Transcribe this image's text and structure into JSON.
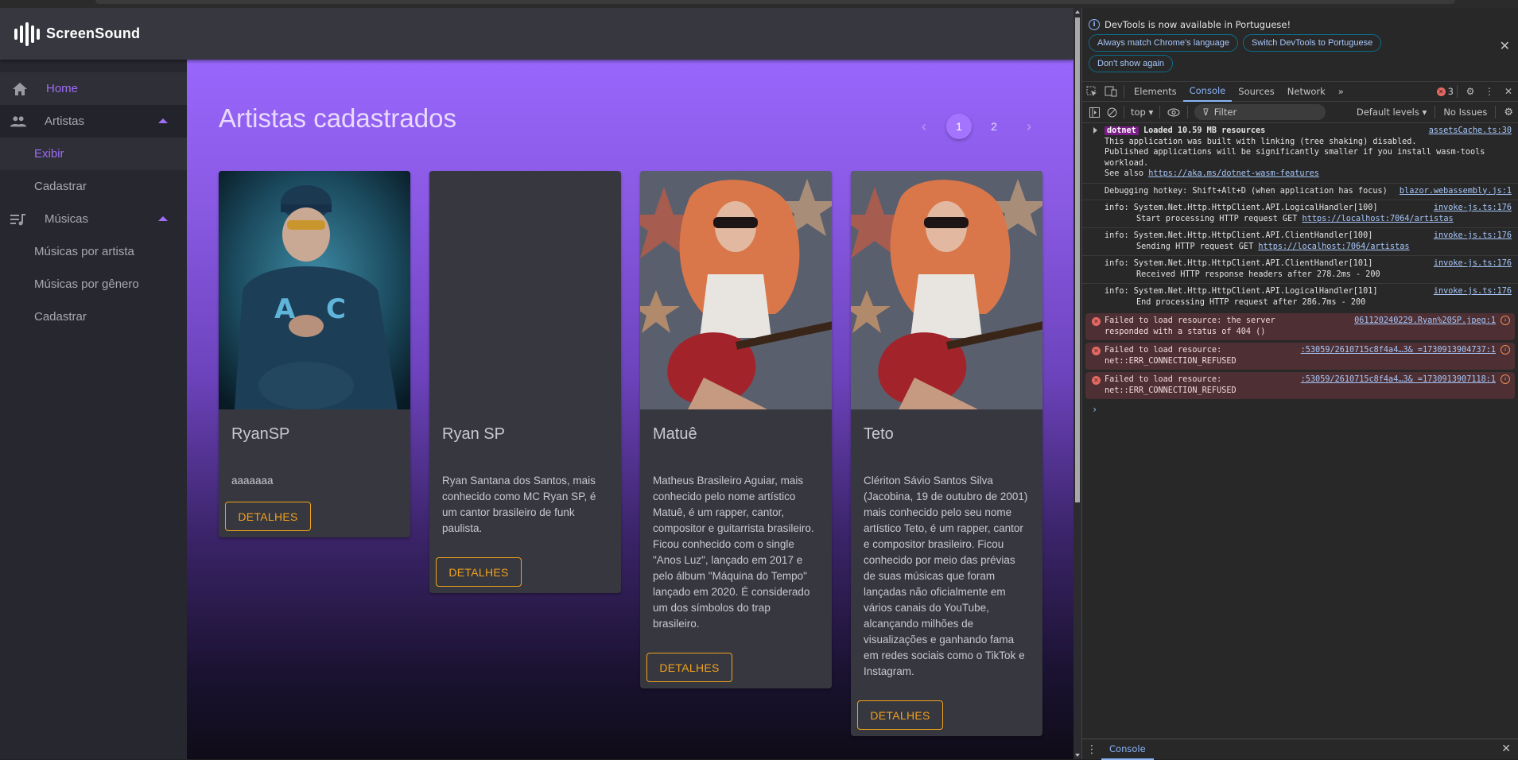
{
  "app": {
    "brand": "ScreenSound",
    "colors": {
      "accent": "#9e6cf6",
      "button": "#f0a21c",
      "card_bg": "#373740",
      "sidebar_bg": "#27272f"
    }
  },
  "sidebar": {
    "items": [
      {
        "label": "Home",
        "icon": "home-icon",
        "active": true
      },
      {
        "label": "Artistas",
        "icon": "people-icon",
        "expanded": true
      },
      {
        "label": "Exibir",
        "sub": true,
        "selected": true
      },
      {
        "label": "Cadastrar",
        "sub": true
      },
      {
        "label": "Músicas",
        "icon": "playlist-music-icon",
        "expanded": true
      },
      {
        "label": "Músicas por artista",
        "sub": true
      },
      {
        "label": "Músicas por gênero",
        "sub": true
      },
      {
        "label": "Cadastrar",
        "sub": true
      }
    ]
  },
  "main": {
    "title": "Artistas cadastrados",
    "pagination": {
      "prev": "‹",
      "pages": [
        "1",
        "2"
      ],
      "current": "1",
      "next": "›"
    },
    "cards": [
      {
        "name": "RyanSP",
        "description": "aaaaaaa",
        "image": "photo-rapper-blue-cap",
        "button": "DETALHES"
      },
      {
        "name": "Ryan SP",
        "description": "Ryan Santana dos Santos, mais conhecido como MC Ryan SP, é um cantor brasileiro de funk paulista.",
        "image": "",
        "button": "DETALHES"
      },
      {
        "name": "Matuê",
        "description": "Matheus Brasileiro Aguiar, mais conhecido pelo nome artístico Matuê, é um rapper, cantor, compositor e guitarrista brasileiro. Ficou conhecido com o single \"Anos Luz\", lançado em 2017 e pelo álbum \"Máquina do Tempo\" lançado em 2020. É considerado um dos símbolos do trap brasileiro.",
        "image": "painting-guitarist-red-hair",
        "button": "DETALHES"
      },
      {
        "name": "Teto",
        "description": "Clériton Sávio Santos Silva (Jacobina, 19 de outubro de 2001) mais conhecido pelo seu nome artístico Teto, é um rapper, cantor e compositor brasileiro. Ficou conhecido por meio das prévias de suas músicas que foram lançadas não oficialmente em vários canais do YouTube, alcançando milhões de visualizações e ganhando fama em redes sociais como o TikTok e Instagram.",
        "image": "painting-guitarist-red-hair",
        "button": "DETALHES"
      }
    ]
  },
  "devtools": {
    "banner": {
      "message": "DevTools is now available in Portuguese!",
      "buttons": [
        "Always match Chrome's language",
        "Switch DevTools to Portuguese",
        "Don't show again"
      ]
    },
    "tabs": [
      "Elements",
      "Console",
      "Sources",
      "Network"
    ],
    "active_tab": "Console",
    "more_tabs": "»",
    "error_count": "3",
    "toolbar": {
      "context": "top ▾",
      "filter_placeholder": "Filter",
      "levels": "Default levels ▾",
      "issues": "No Issues"
    },
    "logs": [
      {
        "type": "group",
        "tag": "dotnet",
        "text": "Loaded 10.59 MB resources",
        "lines": [
          "This application was built with linking (tree shaking) disabled.",
          "Published applications will be significantly smaller if you install wasm-tools workload."
        ],
        "see_also": "See also ",
        "link": "https://aka.ms/dotnet-wasm-features",
        "source": "assetsCache.ts:30"
      },
      {
        "type": "plain",
        "text": "Debugging hotkey: Shift+Alt+D (when application has focus)",
        "source": "blazor.webassembly.js:1"
      },
      {
        "type": "info",
        "line1": "info: System.Net.Http.HttpClient.API.LogicalHandler[100]",
        "line2": "Start processing HTTP request GET ",
        "link": "https://localhost:7064/artistas",
        "source": "invoke-js.ts:176"
      },
      {
        "type": "info",
        "line1": "info: System.Net.Http.HttpClient.API.ClientHandler[100]",
        "line2": "Sending HTTP request GET ",
        "link": "https://localhost:7064/artistas",
        "source": "invoke-js.ts:176"
      },
      {
        "type": "info",
        "line1": "info: System.Net.Http.HttpClient.API.ClientHandler[101]",
        "line2": "Received HTTP response headers after 278.2ms - 200",
        "link": "",
        "source": "invoke-js.ts:176"
      },
      {
        "type": "info",
        "line1": "info: System.Net.Http.HttpClient.API.LogicalHandler[101]",
        "line2": "End processing HTTP request after 286.7ms - 200",
        "link": "",
        "source": "invoke-js.ts:176"
      },
      {
        "type": "error",
        "line1": "Failed to load resource: the server",
        "line2": "responded with a status of 404 ()",
        "source": "061120240229.Ryan%20SP.jpeg:1"
      },
      {
        "type": "error",
        "line1": "Failed to load resource:",
        "line2": "net::ERR_CONNECTION_REFUSED",
        "source": ":53059/2610715c8f4a4…3& =1730913904737:1"
      },
      {
        "type": "error",
        "line1": "Failed to load resource:",
        "line2": "net::ERR_CONNECTION_REFUSED",
        "source": ":53059/2610715c8f4a4…3& =1730913907118:1"
      }
    ],
    "prompt": "›",
    "drawer_tab": "Console"
  }
}
